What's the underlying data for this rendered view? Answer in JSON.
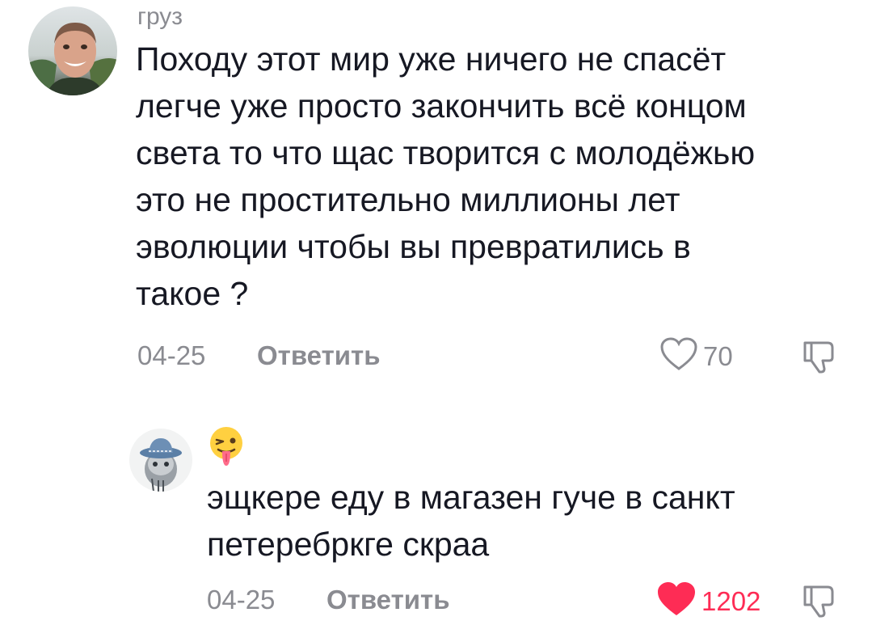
{
  "comments": [
    {
      "username": "груз",
      "avatar_icon": "user-photo-avatar",
      "text": "Походу этот мир уже ничего не спасёт\nлегче уже просто закончить всё концом\nсвета то что щас творится с молодёжью\nэто не простительно миллионы лет\nэволюции чтобы вы превратились в\nтакое ?",
      "date": "04-25",
      "reply_label": "Ответить",
      "like_icon": "heart-outline-icon",
      "likes": "70",
      "liked": false,
      "dislike_icon": "thumbs-down-icon"
    },
    {
      "username_emoji": "winking-tongue-emoji",
      "avatar_icon": "cat-in-hat-avatar",
      "text": "эщкере еду в магазен гуче в санкт\nпетеребркге скраа",
      "date": "04-25",
      "reply_label": "Ответить",
      "like_icon": "heart-filled-icon",
      "likes": "1202",
      "liked": true,
      "dislike_icon": "thumbs-down-icon"
    }
  ],
  "colors": {
    "text": "#161823",
    "muted": "#8a8b91",
    "liked": "#fe2c55"
  }
}
